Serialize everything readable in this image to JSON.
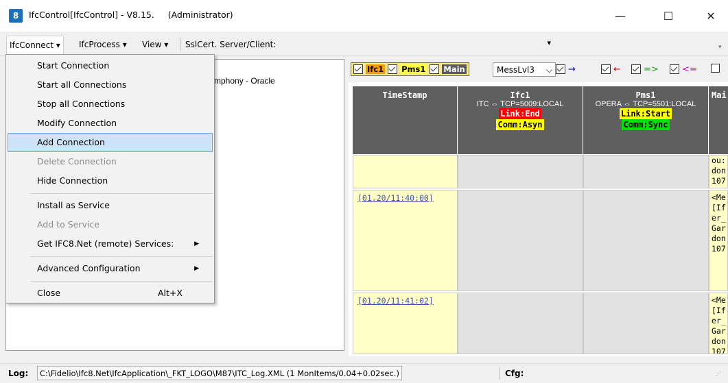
{
  "window": {
    "icon_text": "8",
    "title": "IfcControl[IfcControl] - V8.15.     (Administrator)",
    "minimize": "—",
    "maximize": "☐",
    "close": "✕"
  },
  "menubar": {
    "ifcconnect": "IfcConnect ▾",
    "ifcprocess": "IfcProcess ▾",
    "view": "View ▾",
    "sslcert": "SslCert. Server/Client:",
    "combo_arrow": "▾"
  },
  "dropdown": {
    "items": [
      {
        "label": "Start Connection"
      },
      {
        "label": "Start all Connections"
      },
      {
        "label": "Stop all Connections"
      },
      {
        "label": "Modify Connection"
      },
      {
        "label": "Add Connection"
      },
      {
        "label": "Delete Connection"
      },
      {
        "label": "Hide Connection"
      },
      {
        "label": "Install as Service"
      },
      {
        "label": "Add to Service"
      },
      {
        "label": "Get IFC8.Net (remote) Services:"
      },
      {
        "label": "Advanced Configuration"
      },
      {
        "label": "Close",
        "shortcut": "Alt+X"
      }
    ],
    "submenu_arrow": "▶"
  },
  "left_panel": {
    "partial_text": "mphony - Oracle"
  },
  "filterbar": {
    "toggles": [
      "Ifc1",
      "Pms1",
      "Main"
    ],
    "messlvl": "MessLvl3",
    "messlvl_arrow": "⌵",
    "arrows": [
      "→",
      "←",
      "=>",
      "<="
    ]
  },
  "grid": {
    "columns": [
      {
        "name": "TimeStamp"
      },
      {
        "name": "Ifc1",
        "sub": "ITC ⇔ TCP=5009:LOCAL",
        "link": "Link:End",
        "comm": "Comm:Asyn"
      },
      {
        "name": "Pms1",
        "sub": "OPERA ⇔ TCP=5501:LOCAL",
        "link": "Link:Start",
        "comm": "Comm:Sync"
      },
      {
        "name": "Mai"
      }
    ],
    "rows": [
      {
        "timestamp": "",
        "main_text": "ou:\ndon\n107"
      },
      {
        "timestamp": "[01.20/11:40:00]",
        "main_text": "<Me\n[If\ner_\nGar\ndon\n107"
      },
      {
        "timestamp": "[01.20/11:41:02]",
        "main_text": "<Me\n[If\ner_\nGar\ndon\n107"
      }
    ]
  },
  "statusbar": {
    "log_label": "Log:",
    "log_path": "C:\\Fidelio\\Ifc8.Net\\IfcApplication\\_FKT_LOGO\\M87\\ITC_Log.XML (1 MonItems/0.04+0.02sec.)",
    "cfg_label": "Cfg:"
  },
  "colors": {
    "header_bg": "#5f5f5f",
    "timestamp_bg": "#ffffc6",
    "link_end_bg": "#ff0000",
    "link_start_bg": "#ffff00",
    "comm_asyn_bg": "#ffff00",
    "comm_sync_bg": "#00e000",
    "highlight_bg": "#cde3f7"
  }
}
